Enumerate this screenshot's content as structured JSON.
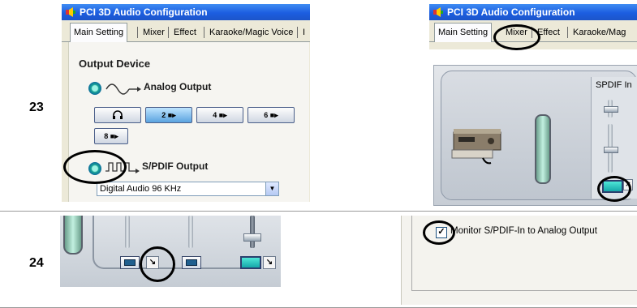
{
  "steps": {
    "s23": "23",
    "s24": "24"
  },
  "window_title": "PCI 3D Audio Configuration",
  "tabs_left": [
    "Main Setting",
    "Mixer",
    "Effect",
    "Karaoke/Magic Voice",
    "I"
  ],
  "tabs_right": [
    "Main Setting",
    "Mixer",
    "Effect",
    "Karaoke/Mag"
  ],
  "output_device": {
    "heading": "Output Device",
    "analog_label": "Analog Output",
    "analog_buttons": [
      "2",
      "4",
      "6",
      "8"
    ],
    "spdif_label": "S/PDIF Output",
    "select_value": "Digital Audio 96 KHz"
  },
  "mixer": {
    "spdif_in_label": "SPDIF In"
  },
  "monitor": {
    "checkbox_label": "Monitor S/PDIF-In to Analog Output",
    "checked": true
  },
  "colors": {
    "titlebar": "#1c5ee0",
    "highlight": "#000000",
    "radio": "#1aa596"
  }
}
